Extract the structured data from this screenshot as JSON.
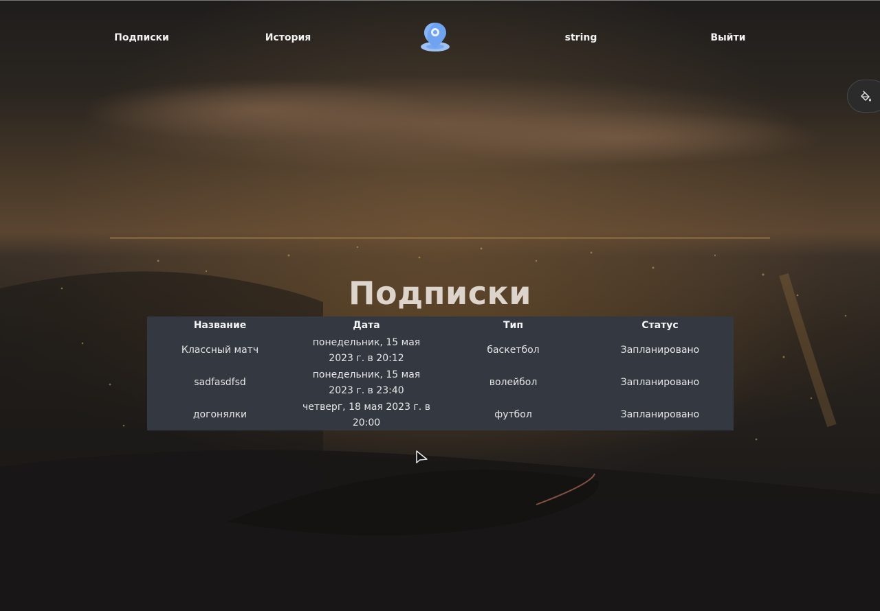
{
  "nav": {
    "items": [
      {
        "label": "Подписки"
      },
      {
        "label": "История"
      },
      {
        "label": "string"
      },
      {
        "label": "Выйти"
      }
    ],
    "logo_icon": "map-pin-icon",
    "accent_color": "#6fa3f0"
  },
  "theme_toggle": {
    "icon": "paint-bucket-icon"
  },
  "page": {
    "title": "Подписки"
  },
  "table": {
    "headers": [
      "Название",
      "Дата",
      "Тип",
      "Статус"
    ],
    "rows": [
      {
        "name": "Классный матч",
        "date": "понедельник, 15 мая 2023 г. в 20:12",
        "type": "баскетбол",
        "status": "Запланировано"
      },
      {
        "name": "sadfasdfsd",
        "date": "понедельник, 15 мая 2023 г. в 23:40",
        "type": "волейбол",
        "status": "Запланировано"
      },
      {
        "name": "догонялки",
        "date": "четверг, 18 мая 2023 г. в 20:00",
        "type": "футбол",
        "status": "Запланировано"
      }
    ],
    "background": "#343941"
  }
}
